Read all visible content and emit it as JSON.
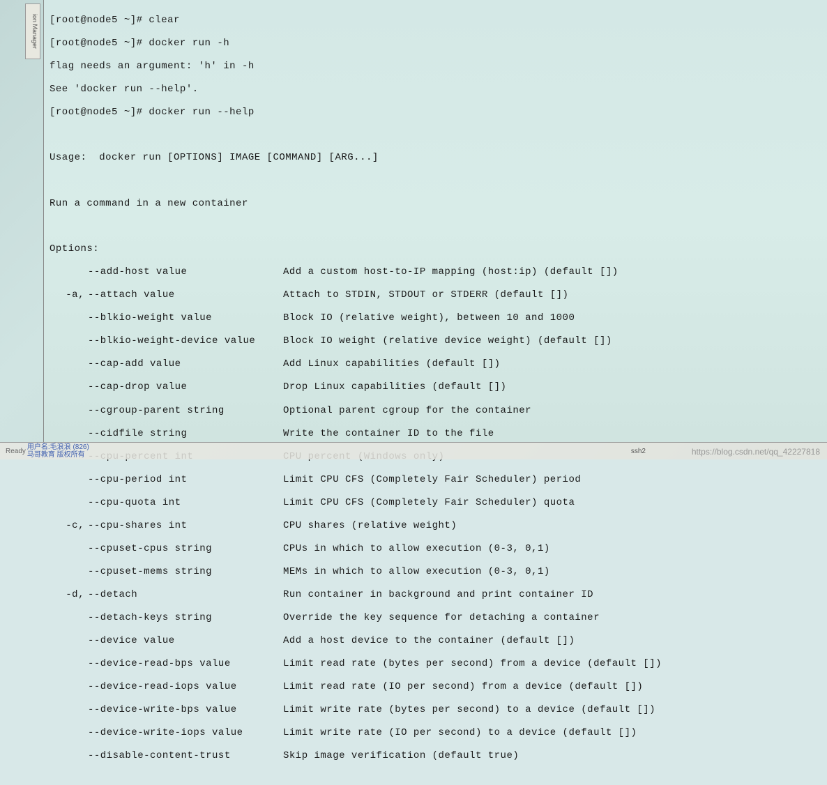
{
  "sidebar": {
    "tab_label": "ion Manager"
  },
  "prompt": {
    "line1": "[root@node5 ~]# clear",
    "line2": "[root@node5 ~]# docker run -h",
    "line3": "flag needs an argument: 'h' in -h",
    "line4": "See 'docker run --help'.",
    "line5": "[root@node5 ~]# docker run --help"
  },
  "usage": "Usage:  docker run [OPTIONS] IMAGE [COMMAND] [ARG...]",
  "subtitle": "Run a command in a new container",
  "options_header": "Options:",
  "options": [
    {
      "prefix": "",
      "flag": "--add-host value",
      "desc": "Add a custom host-to-IP mapping (host:ip) (default [])"
    },
    {
      "prefix": "-a,",
      "flag": "--attach value",
      "desc": "Attach to STDIN, STDOUT or STDERR (default [])"
    },
    {
      "prefix": "",
      "flag": "--blkio-weight value",
      "desc": "Block IO (relative weight), between 10 and 1000"
    },
    {
      "prefix": "",
      "flag": "--blkio-weight-device value",
      "desc": "Block IO weight (relative device weight) (default [])"
    },
    {
      "prefix": "",
      "flag": "--cap-add value",
      "desc": "Add Linux capabilities (default [])"
    },
    {
      "prefix": "",
      "flag": "--cap-drop value",
      "desc": "Drop Linux capabilities (default [])"
    },
    {
      "prefix": "",
      "flag": "--cgroup-parent string",
      "desc": "Optional parent cgroup for the container"
    },
    {
      "prefix": "",
      "flag": "--cidfile string",
      "desc": "Write the container ID to the file"
    },
    {
      "prefix": "",
      "flag": "--cpu-percent int",
      "desc": "CPU percent (Windows only)"
    },
    {
      "prefix": "",
      "flag": "--cpu-period int",
      "desc": "Limit CPU CFS (Completely Fair Scheduler) period"
    },
    {
      "prefix": "",
      "flag": "--cpu-quota int",
      "desc": "Limit CPU CFS (Completely Fair Scheduler) quota"
    },
    {
      "prefix": "-c,",
      "flag": "--cpu-shares int",
      "desc": "CPU shares (relative weight)"
    },
    {
      "prefix": "",
      "flag": "--cpuset-cpus string",
      "desc": "CPUs in which to allow execution (0-3, 0,1)"
    },
    {
      "prefix": "",
      "flag": "--cpuset-mems string",
      "desc": "MEMs in which to allow execution (0-3, 0,1)"
    },
    {
      "prefix": "-d,",
      "flag": "--detach",
      "desc": "Run container in background and print container ID"
    },
    {
      "prefix": "",
      "flag": "--detach-keys string",
      "desc": "Override the key sequence for detaching a container"
    },
    {
      "prefix": "",
      "flag": "--device value",
      "desc": "Add a host device to the container (default [])"
    },
    {
      "prefix": "",
      "flag": "--device-read-bps value",
      "desc": "Limit read rate (bytes per second) from a device (default [])"
    },
    {
      "prefix": "",
      "flag": "--device-read-iops value",
      "desc": "Limit read rate (IO per second) from a device (default [])"
    },
    {
      "prefix": "",
      "flag": "--device-write-bps value",
      "desc": "Limit write rate (bytes per second) to a device (default [])"
    },
    {
      "prefix": "",
      "flag": "--device-write-iops value",
      "desc": "Limit write rate (IO per second) to a device (default [])"
    },
    {
      "prefix": "",
      "flag": "--disable-content-trust",
      "desc": "Skip image verification (default true)"
    }
  ],
  "status": {
    "ready": "Ready",
    "user_label": "用户名:毛浪浪 (826)",
    "org_label": "马哥教育 版权所有",
    "ssh": "ssh2"
  },
  "watermark": "https://blog.csdn.net/qq_42227818"
}
